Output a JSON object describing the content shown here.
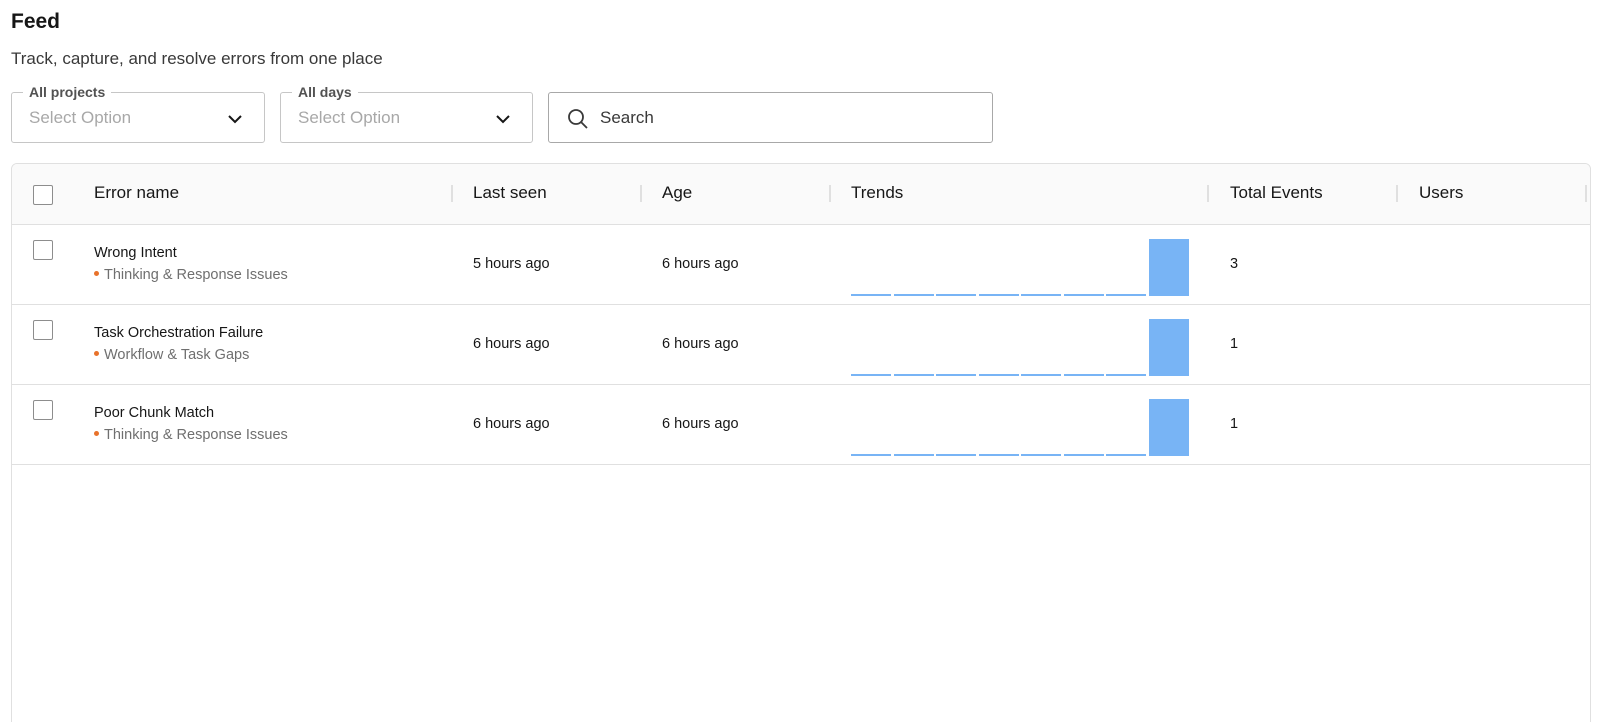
{
  "header": {
    "title": "Feed",
    "subtitle": "Track, capture, and resolve errors from one place"
  },
  "filters": {
    "projects": {
      "legend": "All projects",
      "value": "Select Option"
    },
    "days": {
      "legend": "All days",
      "value": "Select Option"
    },
    "search": {
      "placeholder": "Search",
      "value": ""
    }
  },
  "table": {
    "columns": [
      "Error name",
      "Last seen",
      "Age",
      "Trends",
      "Total Events",
      "Users"
    ],
    "rows": [
      {
        "name": "Wrong Intent",
        "category": "Thinking & Response Issues",
        "last_seen": "5 hours ago",
        "age": "6 hours ago",
        "trend": [
          0,
          0,
          0,
          0,
          0,
          0,
          0,
          3
        ],
        "total_events": "3",
        "users": ""
      },
      {
        "name": "Task Orchestration Failure",
        "category": "Workflow & Task Gaps",
        "last_seen": "6 hours ago",
        "age": "6 hours ago",
        "trend": [
          0,
          0,
          0,
          0,
          0,
          0,
          0,
          1
        ],
        "total_events": "1",
        "users": ""
      },
      {
        "name": "Poor Chunk Match",
        "category": "Thinking & Response Issues",
        "last_seen": "6 hours ago",
        "age": "6 hours ago",
        "trend": [
          0,
          0,
          0,
          0,
          0,
          0,
          0,
          1
        ],
        "total_events": "1",
        "users": ""
      }
    ]
  },
  "colors": {
    "trend_bar": "#78b4f5",
    "category_dot": "#e8722b"
  },
  "icons": {
    "search": "search-icon",
    "dropdown": "chevron-down-icon"
  }
}
